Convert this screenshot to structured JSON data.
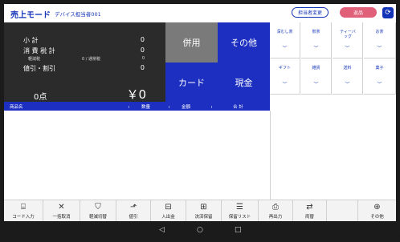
{
  "header": {
    "title": "売上モード",
    "subtitle": "デバイス担当者001",
    "staff_change": "担当者変更",
    "return_label": "返品",
    "refresh_icon": "refresh-icon"
  },
  "summary": {
    "subtotal_label": "小 計",
    "subtotal_value": "0",
    "tax_label": "消 費 税 計",
    "tax_value": "0",
    "reduced_label": "軽減税",
    "reduced_value": "0 / 通常税",
    "reduced_value2": "0",
    "discount_label": "値引・割引",
    "discount_value": "0",
    "items_label": "0点",
    "total_label": "￥0"
  },
  "pay_buttons": {
    "combined": "併用",
    "other": "その他",
    "card": "カード",
    "cash": "現金"
  },
  "categories": [
    {
      "label": "深むし茶"
    },
    {
      "label": "煎茶"
    },
    {
      "label": "ティーバッグ"
    },
    {
      "label": "お茶"
    },
    {
      "label": "ギフト"
    },
    {
      "label": "雑貨"
    },
    {
      "label": "送料"
    },
    {
      "label": "菓子"
    }
  ],
  "table": {
    "col_name": "商品名",
    "col_qty": "数量",
    "col_price": "金額",
    "col_total": "合 計"
  },
  "toolbar": [
    {
      "label": "コード入力",
      "icon": "barcode-icon"
    },
    {
      "label": "一括取消",
      "icon": "close-icon"
    },
    {
      "label": "軽減切替",
      "icon": "tag-icon"
    },
    {
      "label": "値引",
      "icon": "discount-icon"
    },
    {
      "label": "入出金",
      "icon": "cash-drawer-icon"
    },
    {
      "label": "決済保留",
      "icon": "basket-icon"
    },
    {
      "label": "保留リスト",
      "icon": "list-icon"
    },
    {
      "label": "再出力",
      "icon": "printer-icon"
    },
    {
      "label": "両替",
      "icon": "exchange-icon"
    },
    {
      "label": "その他",
      "icon": "plus-icon"
    }
  ],
  "android_nav": [
    "back-icon",
    "home-icon",
    "recents-icon"
  ]
}
